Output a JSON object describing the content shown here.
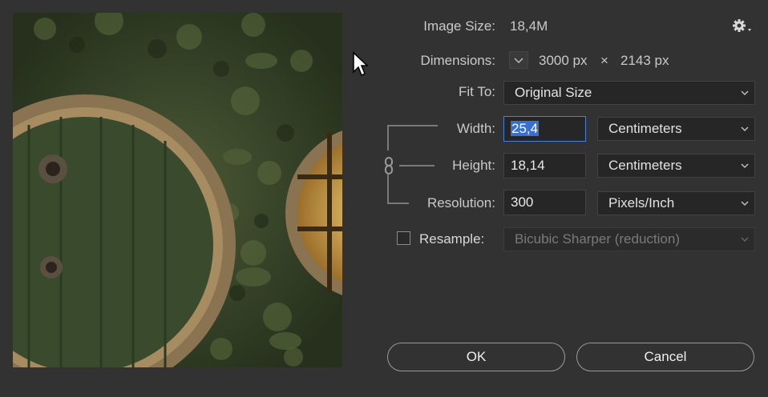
{
  "dialog": {
    "image_size_label": "Image Size:",
    "image_size_value": "18,4M",
    "dimensions_label": "Dimensions:",
    "dim_width": "3000 px",
    "dim_times": "×",
    "dim_height": "2143 px",
    "fit_to_label": "Fit To:",
    "fit_to_value": "Original Size",
    "width_label": "Width:",
    "width_value": "25,4",
    "width_unit": "Centimeters",
    "height_label": "Height:",
    "height_value": "18,14",
    "height_unit": "Centimeters",
    "resolution_label": "Resolution:",
    "resolution_value": "300",
    "resolution_unit": "Pixels/Inch",
    "resample_label": "Resample:",
    "resample_checked": false,
    "resample_value": "Bicubic Sharper (reduction)",
    "ok_label": "OK",
    "cancel_label": "Cancel"
  },
  "icons": {
    "gear": "gear-icon",
    "link": "link-chain-icon",
    "dimensions_toggle": "chevron-down-icon"
  },
  "colors": {
    "background": "#323232",
    "field_bg": "#262626",
    "active_border": "#4a7fd6",
    "selection": "#3a6fd0"
  }
}
